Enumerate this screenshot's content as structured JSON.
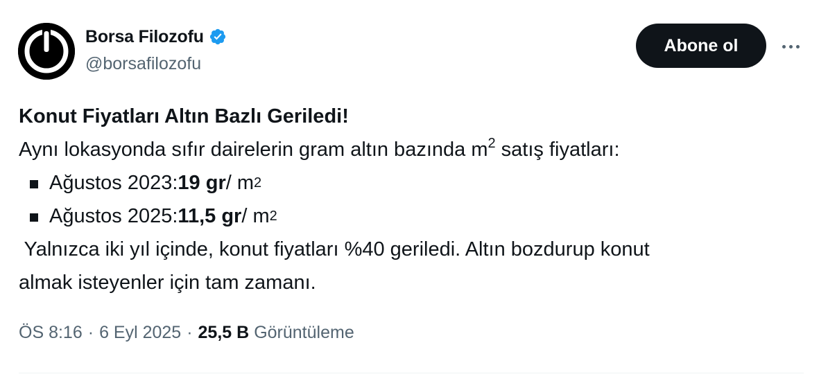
{
  "author": {
    "display_name": "Borsa Filozofu",
    "handle": "@borsafilozofu",
    "verified": true,
    "avatar_icon": "power-button-icon"
  },
  "actions": {
    "follow_label": "Abone ol",
    "more_icon": "more-horizontal-icon"
  },
  "tweet": {
    "title": "Konut Fiyatları Altın Bazlı Geriledi!",
    "intro_before": "Aynı lokasyonda sıfır dairelerin gram altın bazında m",
    "intro_sup": "2",
    "intro_after": " satış fiyatları:",
    "items": [
      {
        "label": "Ağustos 2023: ",
        "value": "19 gr",
        "unit": " / m",
        "unit_sup": "2"
      },
      {
        "label": "Ağustos 2025: ",
        "value": "11,5 gr",
        "unit": " / m",
        "unit_sup": "2"
      }
    ],
    "body_line1": " Yalnızca iki yıl içinde, konut fiyatları %40 geriledi. Altın bozdurup konut",
    "body_line2": "almak isteyenler için tam zamanı."
  },
  "meta": {
    "time": "ÖS 8:16",
    "separator": "·",
    "date": "6 Eyl 2025",
    "views_count": "25,5 B",
    "views_label": "Görüntüleme"
  },
  "colors": {
    "text": "#0f1419",
    "secondary": "#536471",
    "verified_blue": "#1d9bf0",
    "divider": "#eff3f4"
  }
}
